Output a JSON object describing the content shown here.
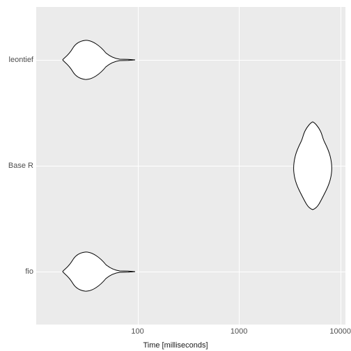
{
  "chart_data": {
    "type": "violin",
    "orientation": "horizontal",
    "x_scale": "log10",
    "xlabel": "Time [milliseconds]",
    "ylabel": "",
    "x_ticks": [
      100,
      1000,
      10000
    ],
    "categories": [
      "fio",
      "Base R",
      "leontief"
    ],
    "series": [
      {
        "name": "fio",
        "distribution_ms": {
          "min": 25,
          "q1": 32,
          "median": 38,
          "q3": 50,
          "max": 95
        },
        "note": "density peaks near ~35ms, long thin right tail to ~95ms"
      },
      {
        "name": "Base R",
        "distribution_ms": {
          "min": 3500,
          "q1": 5000,
          "median": 6300,
          "q3": 7500,
          "max": 9500
        },
        "note": "broad multimodal density between ~3500 and ~9500ms"
      },
      {
        "name": "leontief",
        "distribution_ms": {
          "min": 25,
          "q1": 32,
          "median": 38,
          "q3": 50,
          "max": 95
        },
        "note": "density peaks near ~35ms, long thin right tail to ~95ms"
      }
    ],
    "xlim_log10": [
      1.0,
      4.05
    ]
  },
  "axis": {
    "x_title": "Time [milliseconds]",
    "x_ticks": [
      "100",
      "1000",
      "10000"
    ],
    "y_ticks": [
      "fio",
      "Base R",
      "leontief"
    ]
  }
}
